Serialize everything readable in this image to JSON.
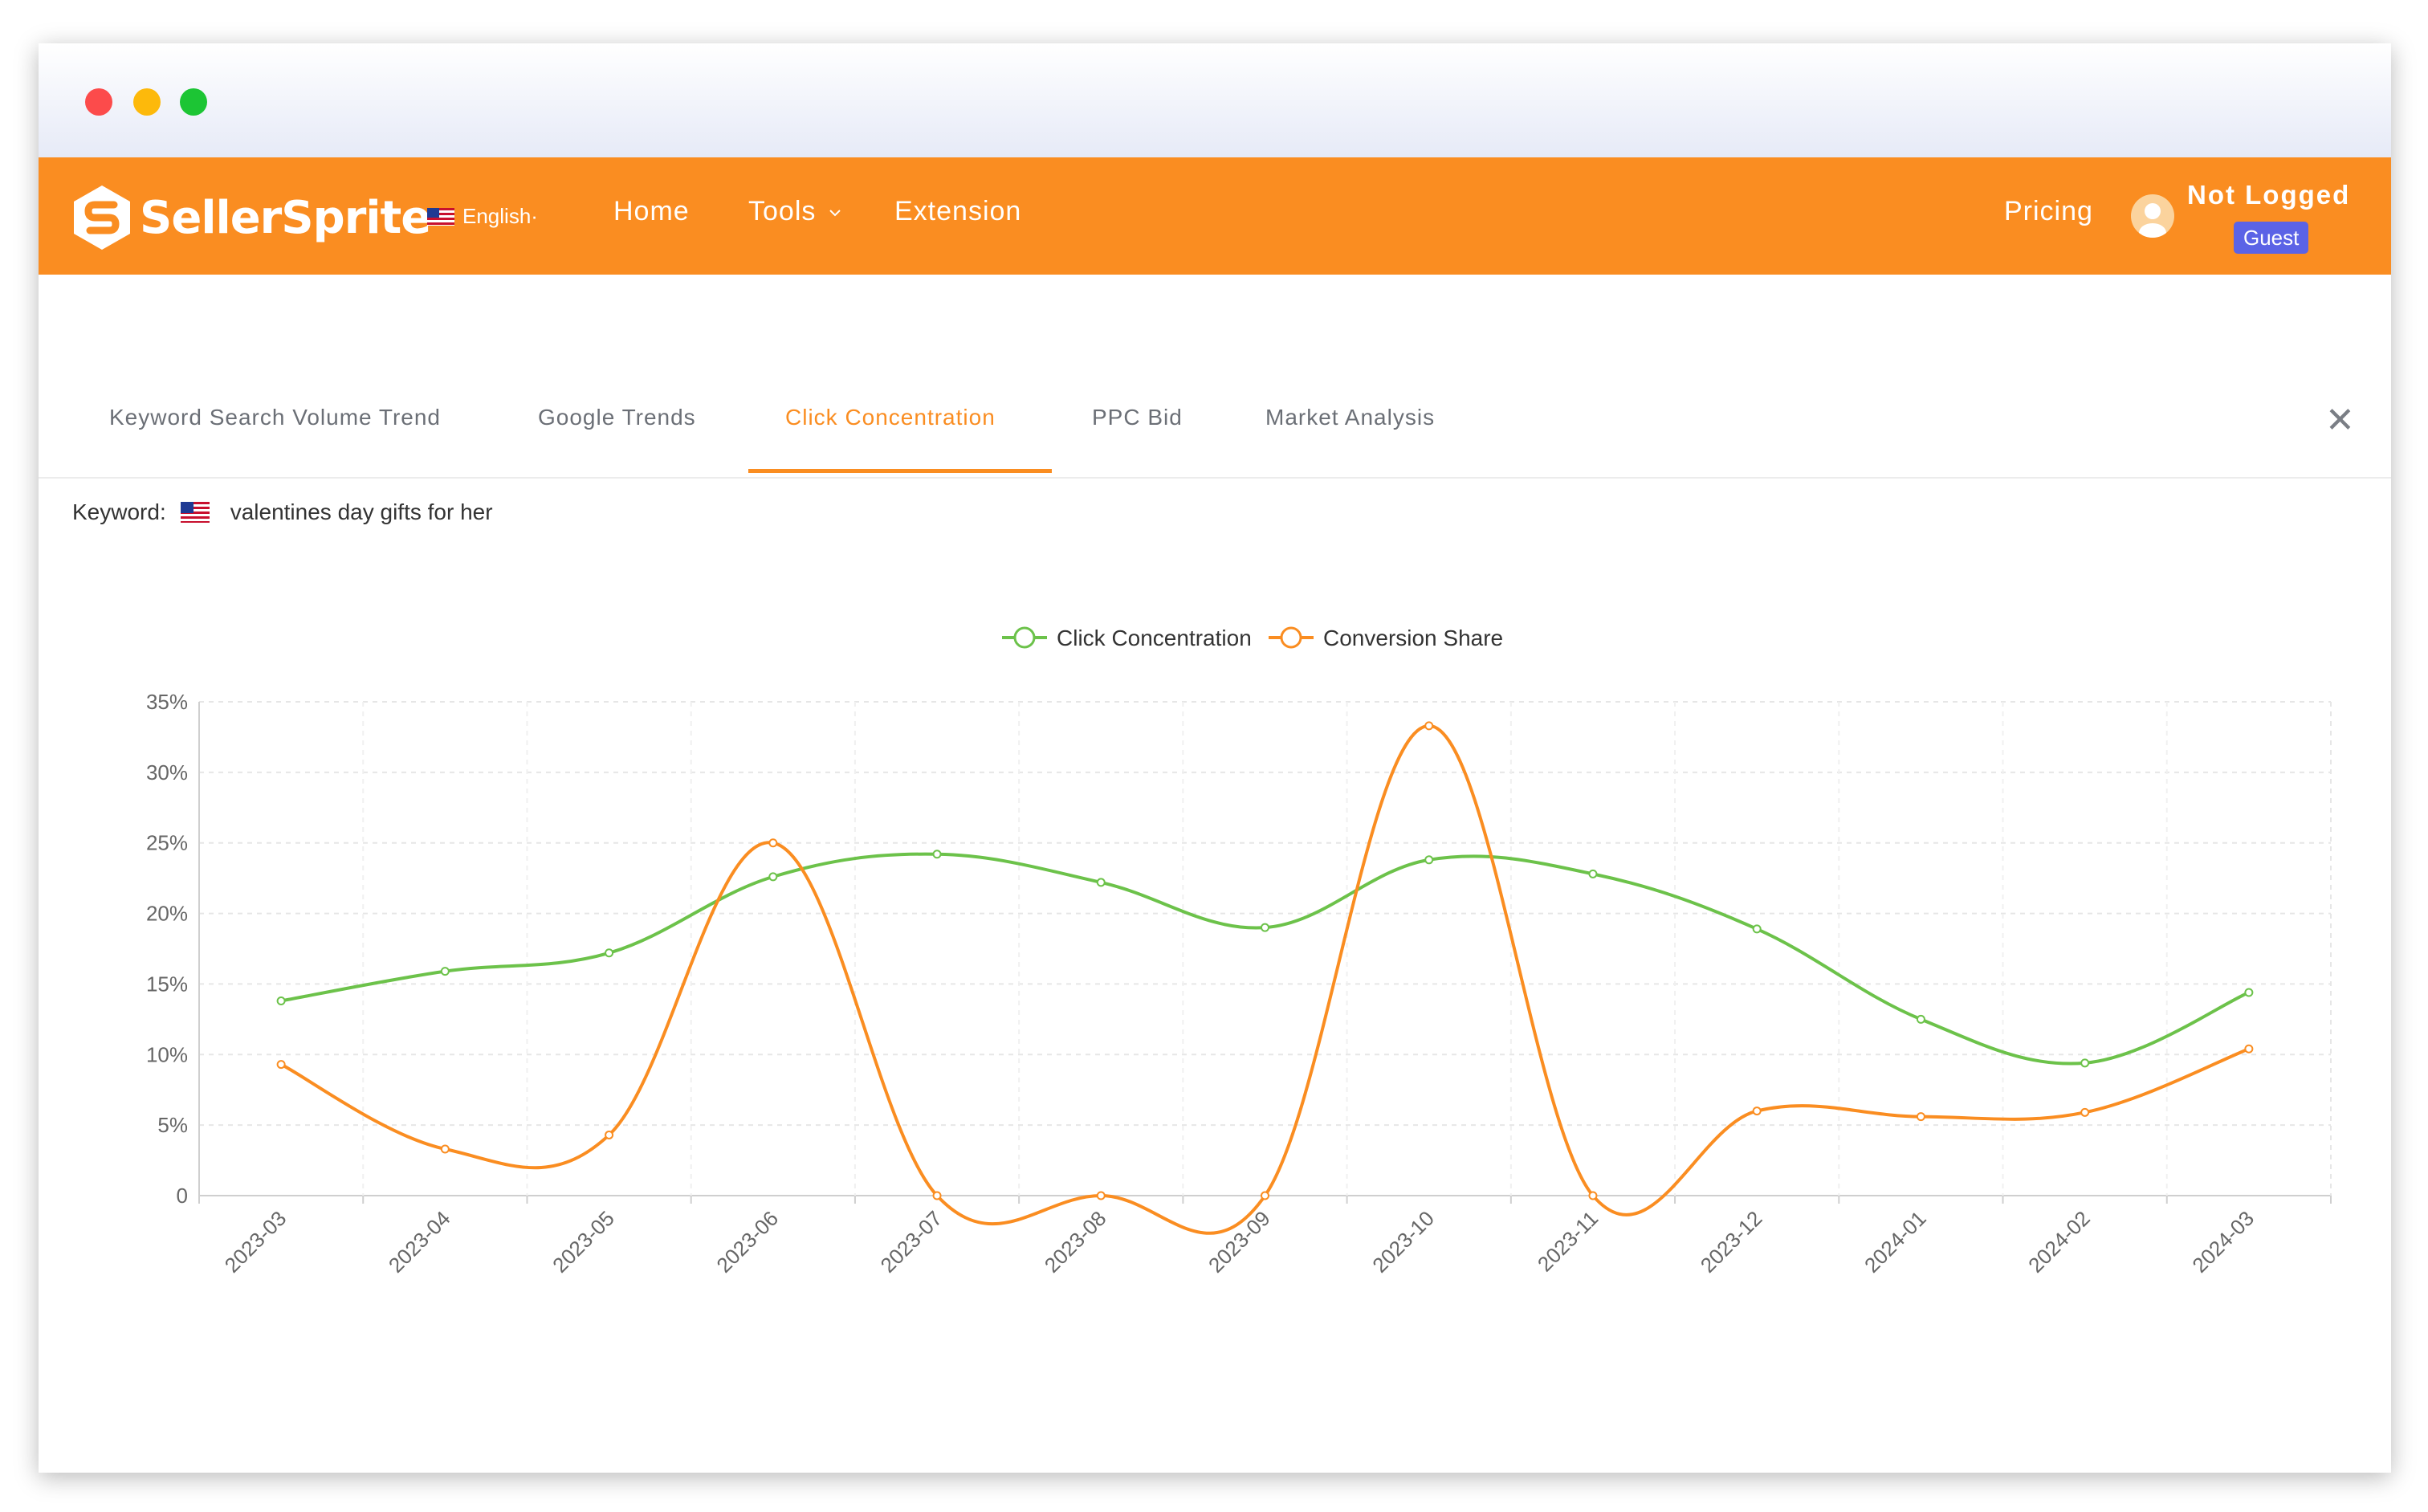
{
  "window": {
    "controls": [
      "close",
      "minimize",
      "zoom"
    ]
  },
  "navbar": {
    "brand": "SellerSprite",
    "language": "English·",
    "links": {
      "home": "Home",
      "tools": "Tools",
      "extension": "Extension",
      "pricing": "Pricing"
    },
    "user": {
      "name": "Not Logged",
      "badge": "Guest"
    },
    "colors": {
      "background": "#fa8d21",
      "badge": "#5b63e6"
    }
  },
  "tabs": {
    "items": [
      {
        "label": "Keyword Search Volume Trend"
      },
      {
        "label": "Google Trends"
      },
      {
        "label": "Click Concentration",
        "active": true
      },
      {
        "label": "PPC Bid"
      },
      {
        "label": "Market Analysis"
      }
    ],
    "close_icon": "close-icon"
  },
  "keyword": {
    "label": "Keyword:",
    "marketplace": "us-flag-icon",
    "value": "valentines day gifts for her"
  },
  "chart_data": {
    "type": "line",
    "smooth": true,
    "x": [
      "2023-03",
      "2023-04",
      "2023-05",
      "2023-06",
      "2023-07",
      "2023-08",
      "2023-09",
      "2023-10",
      "2023-11",
      "2023-12",
      "2024-01",
      "2024-02",
      "2024-03"
    ],
    "series": [
      {
        "name": "Click Concentration",
        "color": "#6cc24a",
        "values": [
          13.8,
          15.9,
          17.2,
          22.6,
          24.2,
          22.2,
          19.0,
          23.8,
          22.8,
          18.9,
          12.5,
          9.4,
          14.4
        ]
      },
      {
        "name": "Conversion Share",
        "color": "#fa8d21",
        "values": [
          9.3,
          3.3,
          4.3,
          25.0,
          0,
          0,
          0,
          33.3,
          0,
          6.0,
          5.6,
          5.9,
          10.4
        ]
      }
    ],
    "y_ticks": [
      "0",
      "5%",
      "10%",
      "15%",
      "20%",
      "25%",
      "30%",
      "35%"
    ],
    "ylim": [
      0,
      35
    ],
    "grid": true,
    "legend_position": "top-center"
  }
}
